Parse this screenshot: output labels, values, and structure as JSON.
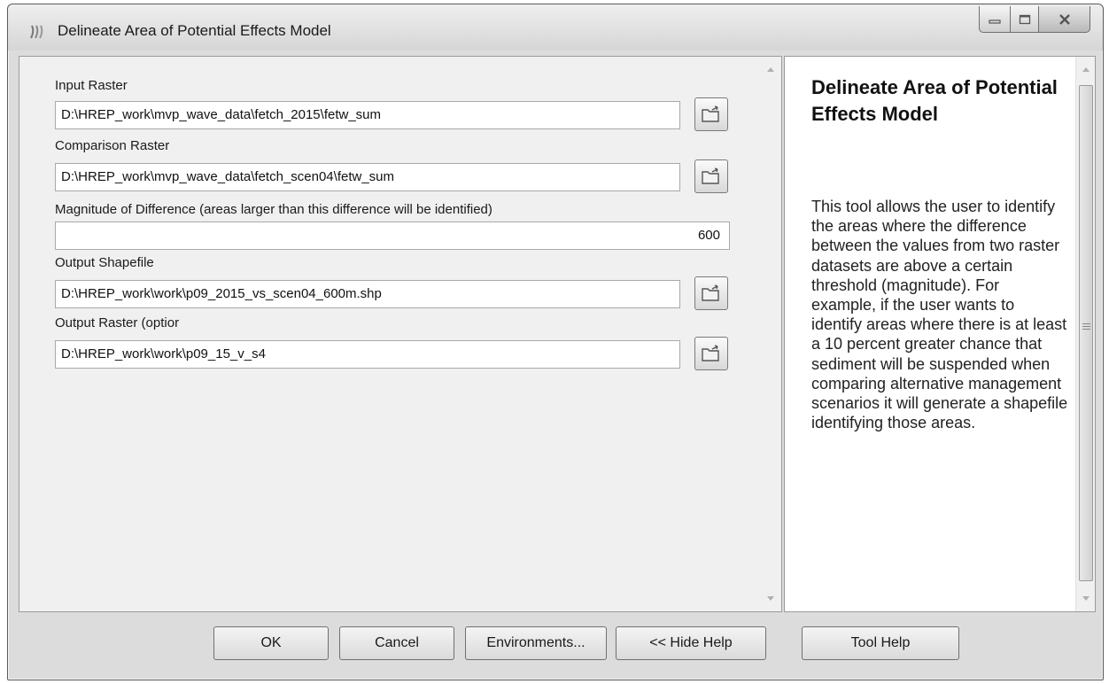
{
  "window": {
    "title": "Delineate Area of Potential Effects Model",
    "min_label": "",
    "max_label": "",
    "close_label": ""
  },
  "form": {
    "fields": [
      {
        "label": "Input Raster",
        "value": "D:\\HREP_work\\mvp_wave_data\\fetch_2015\\fetw_sum",
        "icon": "open-folder-icon"
      },
      {
        "label": "Comparison Raster",
        "value": "D:\\HREP_work\\mvp_wave_data\\fetch_scen04\\fetw_sum",
        "icon": "open-folder-icon"
      },
      {
        "label": "Magnitude of Difference (areas larger than this difference will be identified)",
        "value": "600"
      },
      {
        "label": "Output Shapefile",
        "value": "D:\\HREP_work\\work\\p09_2015_vs_scen04_600m.shp",
        "icon": "open-folder-icon"
      },
      {
        "label": "Output Raster (optior",
        "value": "D:\\HREP_work\\work\\p09_15_v_s4",
        "icon": "open-folder-icon"
      }
    ]
  },
  "help": {
    "title": "Delineate Area of Potential Effects Model",
    "body": "This tool allows the user to identify the areas where the difference between the values from two raster datasets are above a certain threshold (magnitude). For example, if the user wants to identify areas where there is at least a 10 percent greater chance that sediment will be suspended when comparing alternative management scenarios it will generate a shapefile identifying those areas."
  },
  "buttons": {
    "ok": "OK",
    "cancel": "Cancel",
    "environments": "Environments...",
    "hide_help": "<< Hide Help",
    "tool_help": "Tool Help"
  },
  "colors": {
    "window_bg": "#dcdcdc",
    "panel_bg": "#f0f0f0",
    "help_bg": "#ffffff"
  }
}
